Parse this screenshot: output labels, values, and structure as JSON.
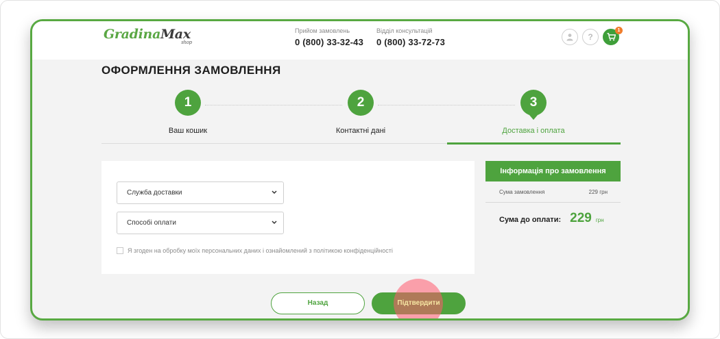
{
  "brand": {
    "name_part1": "Gradina",
    "name_part2": "Max",
    "suffix": "shop",
    "color": "#4ea33e"
  },
  "header": {
    "phone_orders_label": "Прийом замовлень",
    "phone_orders_number": "0 (800) 33-32-43",
    "phone_consult_label": "Відділ консультацій",
    "phone_consult_number": "0 (800) 33-72-73",
    "cart_count": "1"
  },
  "page": {
    "title": "ОФОРМЛЕННЯ ЗАМОВЛЕННЯ"
  },
  "steps": [
    {
      "number": "1",
      "label": "Ваш кошик",
      "active": false
    },
    {
      "number": "2",
      "label": "Контактні дані",
      "active": false
    },
    {
      "number": "3",
      "label": "Доставка і оплата",
      "active": true
    }
  ],
  "form": {
    "delivery_select": "Служба доставки",
    "payment_select": "Способі оплати",
    "consent_text": "Я згоден на обробку моїх персональних даних і ознайомлений з політикою конфіденційності"
  },
  "order_info": {
    "header": "Інформація про замовлення",
    "sum_label": "Сума замовлення",
    "sum_value": "229 грн",
    "total_label": "Сума до оплати:",
    "total_value": "229",
    "total_currency": "грн"
  },
  "buttons": {
    "back": "Назад",
    "confirm": "Підтвердити"
  },
  "colors": {
    "accent": "#4ea33e",
    "badge": "#f07d2c",
    "tap_highlight": "#ff5a6e"
  }
}
